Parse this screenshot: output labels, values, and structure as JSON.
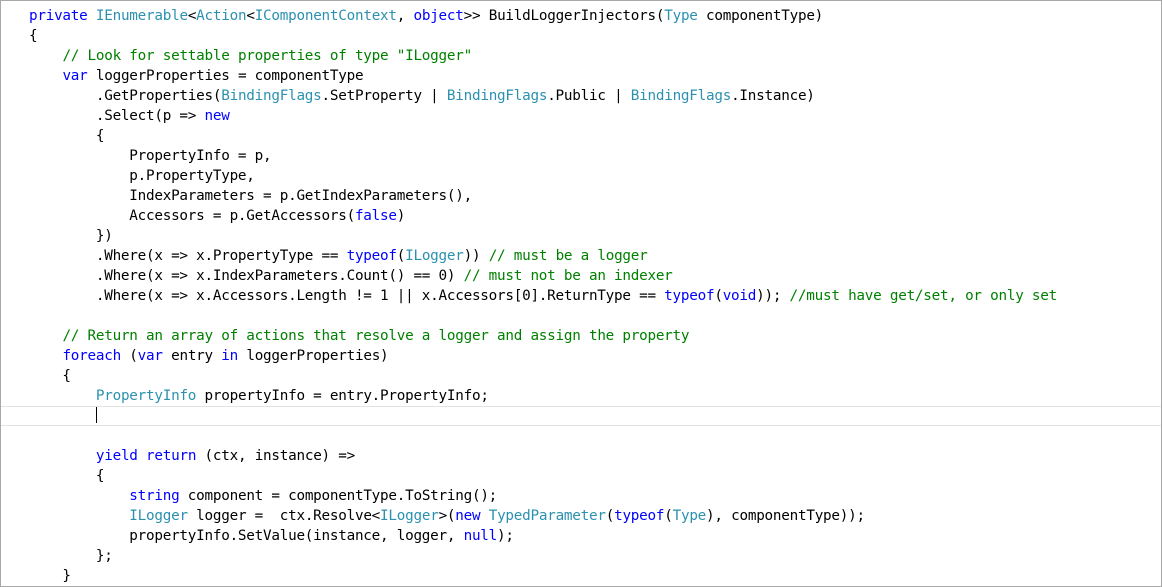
{
  "colors": {
    "keyword": "#0000ff",
    "type": "#2b91af",
    "comment": "#008000",
    "string": "#a31515",
    "plain": "#000000"
  },
  "editor": {
    "current_line": 20,
    "lines": [
      [
        [
          "kw",
          "private "
        ],
        [
          "ty",
          "IEnumerable"
        ],
        [
          "pl",
          "<"
        ],
        [
          "ty",
          "Action"
        ],
        [
          "pl",
          "<"
        ],
        [
          "ty",
          "IComponentContext"
        ],
        [
          "pl",
          ", "
        ],
        [
          "kw",
          "object"
        ],
        [
          "pl",
          ">> BuildLoggerInjectors("
        ],
        [
          "ty",
          "Type"
        ],
        [
          "pl",
          " componentType)"
        ]
      ],
      [
        [
          "pl",
          "{"
        ]
      ],
      [
        [
          "pl",
          "    "
        ],
        [
          "cm",
          "// Look for settable properties of type \"ILogger\""
        ]
      ],
      [
        [
          "pl",
          "    "
        ],
        [
          "kw",
          "var"
        ],
        [
          "pl",
          " loggerProperties = componentType"
        ]
      ],
      [
        [
          "pl",
          "        .GetProperties("
        ],
        [
          "ty",
          "BindingFlags"
        ],
        [
          "pl",
          ".SetProperty | "
        ],
        [
          "ty",
          "BindingFlags"
        ],
        [
          "pl",
          ".Public | "
        ],
        [
          "ty",
          "BindingFlags"
        ],
        [
          "pl",
          ".Instance)"
        ]
      ],
      [
        [
          "pl",
          "        .Select(p => "
        ],
        [
          "kw",
          "new"
        ]
      ],
      [
        [
          "pl",
          "        {"
        ]
      ],
      [
        [
          "pl",
          "            PropertyInfo = p,"
        ]
      ],
      [
        [
          "pl",
          "            p.PropertyType,"
        ]
      ],
      [
        [
          "pl",
          "            IndexParameters = p.GetIndexParameters(),"
        ]
      ],
      [
        [
          "pl",
          "            Accessors = p.GetAccessors("
        ],
        [
          "kw",
          "false"
        ],
        [
          "pl",
          ")"
        ]
      ],
      [
        [
          "pl",
          "        })"
        ]
      ],
      [
        [
          "pl",
          "        .Where(x => x.PropertyType == "
        ],
        [
          "kw",
          "typeof"
        ],
        [
          "pl",
          "("
        ],
        [
          "ty",
          "ILogger"
        ],
        [
          "pl",
          ")) "
        ],
        [
          "cm",
          "// must be a logger"
        ]
      ],
      [
        [
          "pl",
          "        .Where(x => x.IndexParameters.Count() == 0) "
        ],
        [
          "cm",
          "// must not be an indexer"
        ]
      ],
      [
        [
          "pl",
          "        .Where(x => x.Accessors.Length != 1 || x.Accessors[0].ReturnType == "
        ],
        [
          "kw",
          "typeof"
        ],
        [
          "pl",
          "("
        ],
        [
          "kw",
          "void"
        ],
        [
          "pl",
          "));"
        ],
        [
          "cm",
          " //must have get/set, or only set"
        ]
      ],
      [
        [
          "pl",
          ""
        ]
      ],
      [
        [
          "pl",
          "    "
        ],
        [
          "cm",
          "// Return an array of actions that resolve a logger and assign the property"
        ]
      ],
      [
        [
          "pl",
          "    "
        ],
        [
          "kw",
          "foreach"
        ],
        [
          "pl",
          " ("
        ],
        [
          "kw",
          "var"
        ],
        [
          "pl",
          " entry "
        ],
        [
          "kw",
          "in"
        ],
        [
          "pl",
          " loggerProperties)"
        ]
      ],
      [
        [
          "pl",
          "    {"
        ]
      ],
      [
        [
          "pl",
          "        "
        ],
        [
          "ty",
          "PropertyInfo"
        ],
        [
          "pl",
          " propertyInfo = entry.PropertyInfo;"
        ]
      ],
      [
        [
          "pl",
          "        "
        ]
      ],
      [
        [
          "pl",
          ""
        ]
      ],
      [
        [
          "pl",
          "        "
        ],
        [
          "kw",
          "yield"
        ],
        [
          "pl",
          " "
        ],
        [
          "kw",
          "return"
        ],
        [
          "pl",
          " (ctx, instance) =>"
        ]
      ],
      [
        [
          "pl",
          "        {"
        ]
      ],
      [
        [
          "pl",
          "            "
        ],
        [
          "kw",
          "string"
        ],
        [
          "pl",
          " component = componentType.ToString();"
        ]
      ],
      [
        [
          "pl",
          "            "
        ],
        [
          "ty",
          "ILogger"
        ],
        [
          "pl",
          " logger =  ctx.Resolve<"
        ],
        [
          "ty",
          "ILogger"
        ],
        [
          "pl",
          ">("
        ],
        [
          "kw",
          "new"
        ],
        [
          "pl",
          " "
        ],
        [
          "ty",
          "TypedParameter"
        ],
        [
          "pl",
          "("
        ],
        [
          "kw",
          "typeof"
        ],
        [
          "pl",
          "("
        ],
        [
          "ty",
          "Type"
        ],
        [
          "pl",
          "), componentType));"
        ]
      ],
      [
        [
          "pl",
          "            propertyInfo.SetValue(instance, logger, "
        ],
        [
          "kw",
          "null"
        ],
        [
          "pl",
          ");"
        ]
      ],
      [
        [
          "pl",
          "        };"
        ]
      ],
      [
        [
          "pl",
          "    }"
        ]
      ],
      [
        [
          "pl",
          "}"
        ]
      ]
    ]
  }
}
